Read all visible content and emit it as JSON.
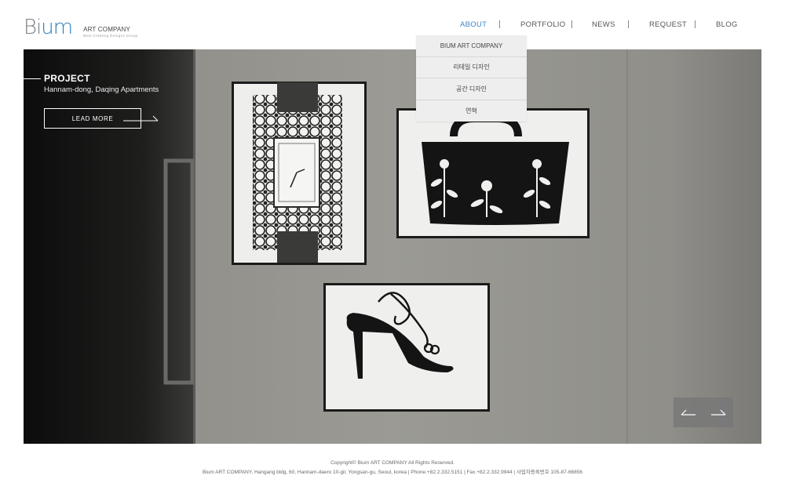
{
  "header": {
    "logo": {
      "mark_prefix": "Bi",
      "mark_suffix": "um",
      "name": "ART COMPANY",
      "tagline": "Best Creating Designs Group"
    },
    "nav": [
      {
        "label": "ABOUT",
        "active": true
      },
      {
        "label": "PORTFOLIO",
        "active": false
      },
      {
        "label": "NEWS",
        "active": false
      },
      {
        "label": "REQUEST",
        "active": false
      },
      {
        "label": "BLOG",
        "active": false
      }
    ]
  },
  "dropdown": {
    "items": [
      "BIUM ART COMPANY",
      "리테일 디자인",
      "공간 디자인",
      "연혁"
    ]
  },
  "hero": {
    "title": "PROJECT",
    "subtitle": "Hannam-dong, Daqing Apartments",
    "cta_label": "LEAD MORE",
    "prev_icon": "arrow-left-icon",
    "next_icon": "arrow-right-icon"
  },
  "footer": {
    "copyright": "Copyright© Bium ART COMPANY All Rights Reserved.",
    "address": "Bium ART COMPANY, Hangang bldg, 60, Hannam-daero 10-gil, Yongsan-gu, Seoul, korea  |  Phone.+82.2.332.5151  |  Fax.+82.2.332.9944  |  사업자등록번호 105-87-66856"
  },
  "colors": {
    "accent": "#3a86c8",
    "nav_text": "#555555",
    "dropdown_bg": "#eeeeee"
  }
}
